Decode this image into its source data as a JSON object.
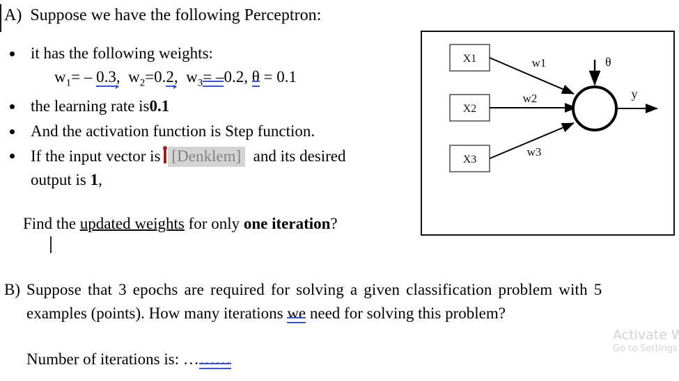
{
  "page": {
    "background": "#ffffff",
    "text_color": "#000000",
    "grammar_underline_color": "#3b55c4",
    "field_marker_color": "#9b2222",
    "field_chip_bg": "#d4d4d4",
    "field_chip_fg": "#828282"
  },
  "part_a": {
    "marker": "A)",
    "heading": "Suppose we have the following Perceptron:",
    "bullets": {
      "weights_intro": "it has the following weights:",
      "learning_rate_prefix": "the learning rate is ",
      "learning_rate_value": "0.1",
      "activation": "And the activation function is Step function.",
      "input_prefix": "If the input vector is",
      "input_field": "[Denklem]",
      "input_suffix": "and its desired",
      "input_line2_prefix": "output is ",
      "input_line2_value": "1",
      "input_line2_suffix": ","
    },
    "weights": {
      "w1_label": "w",
      "w1_sub": "1",
      "w1_eq": "= – ",
      "w1_value": "0.3",
      "w1_comma": ",",
      "w2_label": "w",
      "w2_sub": "2",
      "w2_eq": "=0.",
      "w2_value": "2",
      "w2_comma": ",",
      "w3_label": "w",
      "w3_sub": "3",
      "w3_eq": "=",
      "w3_neg": " – ",
      "w3_value": "0.2,",
      "theta_label": "θ",
      "theta_eq": " = 0.1"
    },
    "question": {
      "prefix": "Find the ",
      "underlined": "updated weights",
      "middle": " for only ",
      "bold": "one iteration",
      "suffix": "?"
    }
  },
  "part_b": {
    "marker": "B)",
    "line1": "Suppose that 3 epochs are required for solving a given classification problem with 5",
    "line2_before": "examples (points). How many iterations ",
    "line2_underlined": "we",
    "line2_after": " need for solving this problem?",
    "answer_label": "Number of iterations is: …",
    "answer_blank": "……"
  },
  "diagram": {
    "inputs": [
      "X1",
      "X2",
      "X3"
    ],
    "weight_labels": [
      "w1",
      "w2",
      "w3"
    ],
    "theta_label": "θ",
    "output_label": "y"
  },
  "watermark": {
    "title": "Activate W",
    "subtitle": "Go to Settings"
  }
}
